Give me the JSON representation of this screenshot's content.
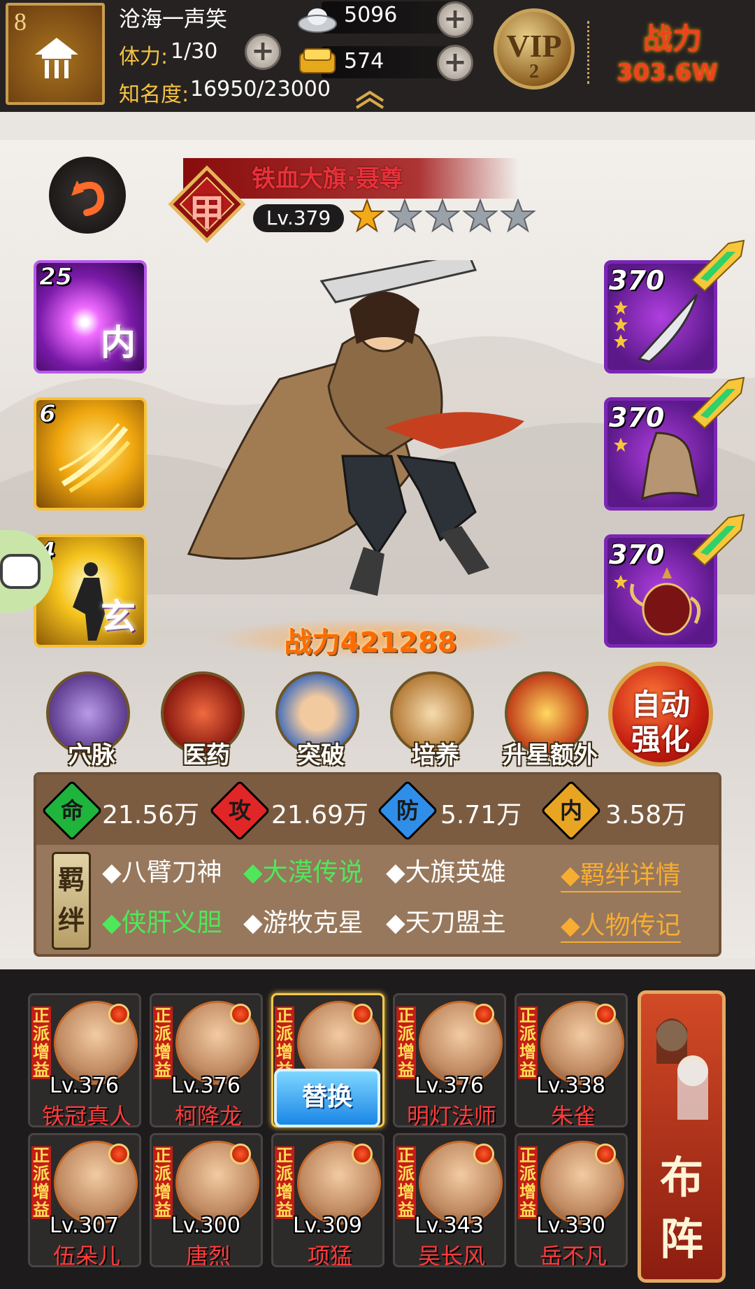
{
  "player": {
    "level": "8",
    "name": "沧海一声笑",
    "stamina_label": "体力:",
    "stamina_value": "1/30",
    "fame_label": "知名度:",
    "fame_value": "16950/23000",
    "silver": "5096",
    "gold": "574",
    "vip_label": "VIP",
    "vip_level": "2",
    "power_label": "战力",
    "power_value": "303.6W"
  },
  "hero": {
    "name": "铁血大旗·聂尊",
    "rank_glyph": "甲",
    "level": "Lv.379",
    "stars_filled": 1,
    "stars_total": 5,
    "power": "战力421288"
  },
  "skills": [
    {
      "count": "25",
      "glyph": "内",
      "color": "purple"
    },
    {
      "count": "6",
      "glyph": "",
      "color": "gold"
    },
    {
      "count": "4",
      "glyph": "玄",
      "color": "gold"
    }
  ],
  "equipment": [
    {
      "level": "370",
      "stars": 3,
      "item": "blade-icon"
    },
    {
      "level": "370",
      "stars": 1,
      "item": "cloak-icon"
    },
    {
      "level": "370",
      "stars": 1,
      "item": "teapot-icon"
    }
  ],
  "functions": [
    {
      "label": "穴脉",
      "icon": "meridian-icon"
    },
    {
      "label": "医药",
      "icon": "herb-icon"
    },
    {
      "label": "突破",
      "icon": "breakthrough-icon"
    },
    {
      "label": "培养",
      "icon": "scroll-icon"
    },
    {
      "label": "升星额外",
      "icon": "star-up-icon"
    }
  ],
  "auto_strengthen": {
    "line1": "自动",
    "line2": "强化"
  },
  "stats": [
    {
      "glyph": "命",
      "value": "21.56万",
      "color": "#1fb53c"
    },
    {
      "glyph": "攻",
      "value": "21.69万",
      "color": "#e02626"
    },
    {
      "glyph": "防",
      "value": "5.71万",
      "color": "#2f8ee8"
    },
    {
      "glyph": "内",
      "value": "3.58万",
      "color": "#e8a524"
    }
  ],
  "bond_tag": [
    "羁",
    "绊"
  ],
  "bonds": [
    {
      "text": "◆八臂刀神",
      "active": false
    },
    {
      "text": "◆大漠传说",
      "active": true
    },
    {
      "text": "◆大旗英雄",
      "active": false
    },
    {
      "text": "◆侠肝义胆",
      "active": true
    },
    {
      "text": "◆游牧克星",
      "active": false
    },
    {
      "text": "◆天刀盟主",
      "active": false
    }
  ],
  "links": {
    "bond_details": "◆羁绊详情",
    "biography": "◆人物传记"
  },
  "roster_tag": "正派增益",
  "roster": [
    {
      "level": "Lv.376",
      "name": "铁冠真人"
    },
    {
      "level": "Lv.376",
      "name": "柯降龙"
    },
    {
      "level": "",
      "name": "",
      "selected": true
    },
    {
      "level": "Lv.376",
      "name": "明灯法师"
    },
    {
      "level": "Lv.338",
      "name": "朱雀"
    },
    {
      "level": "Lv.307",
      "name": "伍朵儿"
    },
    {
      "level": "Lv.300",
      "name": "唐烈"
    },
    {
      "level": "Lv.309",
      "name": "项猛"
    },
    {
      "level": "Lv.343",
      "name": "吴长风"
    },
    {
      "level": "Lv.330",
      "name": "岳不凡"
    }
  ],
  "replace_label": "替换",
  "formation": {
    "line1": "布",
    "line2": "阵"
  }
}
